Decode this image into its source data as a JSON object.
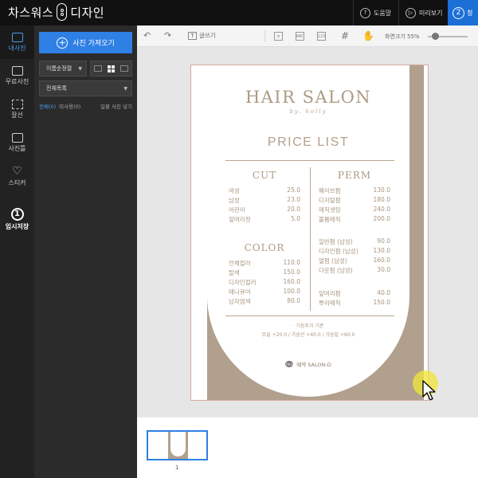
{
  "app": {
    "title_left": "차스워스",
    "title_right": "디자인"
  },
  "top_nav": {
    "help_label": "도움말",
    "preview_label": "미리보기",
    "step_number": "2",
    "step_label": "청"
  },
  "rail": {
    "items": [
      {
        "label": "내사진",
        "icon": "photo-icon",
        "active": true
      },
      {
        "label": "무료사진",
        "icon": "free-photo-icon",
        "active": false
      },
      {
        "label": "잘선",
        "icon": "crop-icon",
        "active": false
      },
      {
        "label": "사진틀",
        "icon": "frame-icon",
        "active": false
      },
      {
        "label": "스티커",
        "icon": "heart-icon",
        "active": false
      },
      {
        "label": "임시저장",
        "icon": "save-number-icon",
        "number": "1",
        "active": false
      }
    ]
  },
  "panel": {
    "import_button": "사진 가져오기",
    "sort_select": "이름순정렬",
    "folder_select": "전체목록",
    "filter_all": "전체(0)",
    "filter_unused": "미사용(0)",
    "filter_hide": "일괄 사진 넣기"
  },
  "toolbar": {
    "text_tool": "글쓰기",
    "zoom_label": "화면크기",
    "zoom_value": "55%",
    "zoom_fraction": 0.1
  },
  "design": {
    "title": "HAIR SALON",
    "subtitle": "by. holly",
    "price_title": "PRICE LIST",
    "cut": {
      "title": "CUT",
      "items": [
        {
          "name": "여성",
          "price": "25.0"
        },
        {
          "name": "남성",
          "price": "23.0"
        },
        {
          "name": "어린이",
          "price": "20.0"
        },
        {
          "name": "앞머리컷",
          "price": "5.0"
        }
      ]
    },
    "color": {
      "title": "COLOR",
      "items": [
        {
          "name": "전체컬러",
          "price": "110.0"
        },
        {
          "name": "탈색",
          "price": "150.0"
        },
        {
          "name": "디자인컬러",
          "price": "160.0"
        },
        {
          "name": "매니큐어",
          "price": "100.0"
        },
        {
          "name": "남자염색",
          "price": "80.0"
        }
      ]
    },
    "perm": {
      "title": "PERM",
      "items": [
        {
          "name": "웨이브펌",
          "price": "130.0"
        },
        {
          "name": "디지털펌",
          "price": "180.0"
        },
        {
          "name": "매직셋팅",
          "price": "240.0"
        },
        {
          "name": "볼륨매직",
          "price": "200.0"
        }
      ]
    },
    "perm_men": {
      "items": [
        {
          "name": "일반펌 (남성)",
          "price": "90.0"
        },
        {
          "name": "디자인펌 (남성)",
          "price": "130.0"
        },
        {
          "name": "열펌 (남성)",
          "price": "160.0"
        },
        {
          "name": "다운펌 (남성)",
          "price": "30.0"
        }
      ]
    },
    "extra": {
      "items": [
        {
          "name": "앞머리펌",
          "price": "40.0"
        },
        {
          "name": "뿌리매직",
          "price": "150.0"
        }
      ]
    },
    "note_line1": "· 기장추가 기준",
    "note_line2": "뮤골 +20.0 / 가슴선 +40.0 / 가슴밑 +60.0",
    "booking": "예약 SALON-D"
  },
  "thumbnails": {
    "page_number": "1"
  },
  "colors": {
    "accent": "#2f80e5",
    "design_beige": "#b1a08d",
    "design_text": "#ad9a84",
    "topbar": "#111111"
  }
}
